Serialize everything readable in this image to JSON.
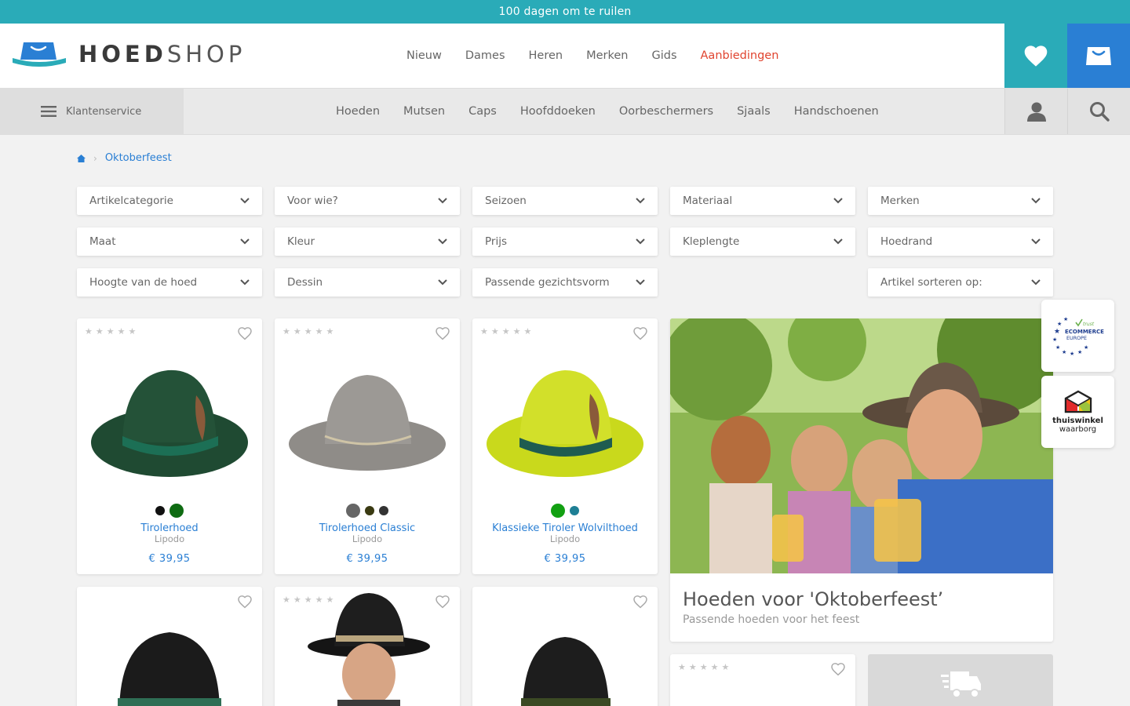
{
  "topbar": {
    "text": "100 dagen om te ruilen"
  },
  "header": {
    "logo": {
      "bold": "HOED",
      "light": "SHOP"
    },
    "nav": [
      "Nieuw",
      "Dames",
      "Heren",
      "Merken",
      "Gids",
      "Aanbiedingen"
    ]
  },
  "subbar": {
    "service_label": "Klantenservice",
    "nav": [
      "Hoeden",
      "Mutsen",
      "Caps",
      "Hoofddoeken",
      "Oorbeschermers",
      "Sjaals",
      "Handschoenen"
    ]
  },
  "breadcrumb": {
    "current": "Oktoberfeest"
  },
  "filters": [
    "Artikelcategorie",
    "Voor wie?",
    "Seizoen",
    "Materiaal",
    "Merken",
    "Maat",
    "Kleur",
    "Prijs",
    "Kleplengte",
    "Hoedrand",
    "Hoogte van de hoed",
    "Dessin",
    "Passende gezichtsvorm",
    "Artikel sorteren op:"
  ],
  "products": [
    {
      "name": "Tirolerhoed",
      "brand": "Lipodo",
      "price": "€ 39,95",
      "swatches": [
        "#111111",
        "#0e6b12"
      ],
      "hat_color": "#1f4a32"
    },
    {
      "name": "Tirolerhoed Classic",
      "brand": "Lipodo",
      "price": "€ 39,95",
      "swatches": [
        "#666666",
        "#3a3a12",
        "#333333"
      ],
      "hat_color": "#8f8c88"
    },
    {
      "name": "Klassieke Tiroler Wolvilthoed",
      "brand": "Lipodo",
      "price": "€ 39,95",
      "swatches": [
        "#12a012",
        "#1e7f95"
      ],
      "hat_color": "#c9d91c"
    }
  ],
  "promo": {
    "title": "Hoeden voor 'Oktoberfeest’",
    "subtitle": "Passende hoeden voor het feest"
  },
  "trust": {
    "ecommerce_lines": [
      "trust",
      "ECOMMERCE",
      "EUROPE"
    ],
    "thuiswinkel": {
      "line1": "thuiswinkel",
      "line2": "waarborg"
    }
  },
  "colors": {
    "teal": "#2aabb8",
    "blue": "#2a7fd4",
    "sale_red": "#e0442f"
  }
}
